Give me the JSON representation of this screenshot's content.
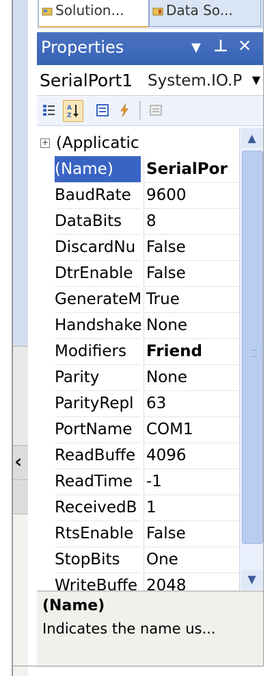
{
  "tabs": [
    {
      "label": "Solution...",
      "icon": "solution-explorer-icon"
    },
    {
      "label": "Data So...",
      "icon": "data-sources-icon"
    }
  ],
  "panel": {
    "title": "Properties",
    "dropdown_glyph": "▼",
    "pin_glyph": "⊥",
    "close_glyph": "✕"
  },
  "object_selector": {
    "name": "SerialPort1",
    "type": "System.IO.P"
  },
  "toolbar": {
    "buttons": [
      "categorized-icon",
      "alphabetical-icon",
      "properties-icon",
      "events-icon",
      "property-pages-icon"
    ],
    "active": "alphabetical-icon"
  },
  "grid": {
    "category": {
      "name": "(Applicatic",
      "expander": "⊞"
    },
    "rows": [
      {
        "name": "(Name)",
        "value": "SerialPor",
        "selected": true,
        "bold": true
      },
      {
        "name": "BaudRate",
        "value": "9600"
      },
      {
        "name": "DataBits",
        "value": "8"
      },
      {
        "name": "DiscardNu",
        "value": "False"
      },
      {
        "name": "DtrEnable",
        "value": "False"
      },
      {
        "name": "GenerateM",
        "value": "True"
      },
      {
        "name": "Handshake",
        "value": "None"
      },
      {
        "name": "Modifiers",
        "value": "Friend",
        "bold": true
      },
      {
        "name": "Parity",
        "value": "None"
      },
      {
        "name": "ParityRepl",
        "value": "63"
      },
      {
        "name": "PortName",
        "value": "COM1"
      },
      {
        "name": "ReadBuffe",
        "value": "4096"
      },
      {
        "name": "ReadTime",
        "value": "-1"
      },
      {
        "name": "ReceivedB",
        "value": "1"
      },
      {
        "name": "RtsEnable",
        "value": "False"
      },
      {
        "name": "StopBits",
        "value": "One"
      },
      {
        "name": "WriteBuffe",
        "value": "2048"
      }
    ]
  },
  "description": {
    "title": "(Name)",
    "text": "Indicates the name us..."
  },
  "colors": {
    "title_bar": "#3a64c4",
    "selection": "#3a64c4",
    "scroll_thumb": "#b9cdf0"
  }
}
